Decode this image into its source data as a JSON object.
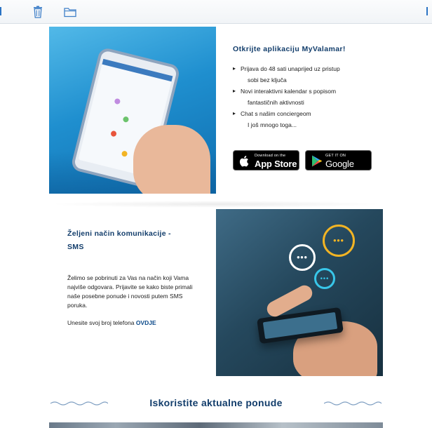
{
  "toolbar": {
    "trash_icon": "trash-icon",
    "folder_icon": "folder-icon",
    "accent": "#2b73c4"
  },
  "app_promo": {
    "title": "Otkrijte aplikaciju MyValamar!",
    "bullets": [
      {
        "line1": "Prijava do 48 sati unaprijed uz pristup",
        "line2": "sobi bez ključa"
      },
      {
        "line1": "Novi interaktivni kalendar s popisom",
        "line2": "fantastičnih aktivnosti"
      },
      {
        "line1": "Chat s našim conciergeom",
        "line2": ""
      }
    ],
    "extra": "I još mnogo toga...",
    "app_store": {
      "small": "Download on the",
      "big": "App Store"
    },
    "google_play": {
      "small": "GET IT ON",
      "big": "Google Play"
    }
  },
  "sms": {
    "title_line1": "Željeni način komunikacije -",
    "title_line2": "SMS",
    "body": "Želimo se pobrinuti za Vas na način koji Vama najviše odgovara. Prijavite se kako biste primali naše posebne ponude i novosti putem SMS poruka.",
    "cta_prefix": "Unesite svoj broj telefona ",
    "cta_link": "OVDJE",
    "bubble_dots": "•••"
  },
  "offers": {
    "title": "Iskoristite aktualne ponude"
  },
  "colors": {
    "heading": "#123d6b",
    "link": "#0c4a8a",
    "bubble_yellow": "#f2b424",
    "bubble_cyan": "#38c6e9"
  }
}
